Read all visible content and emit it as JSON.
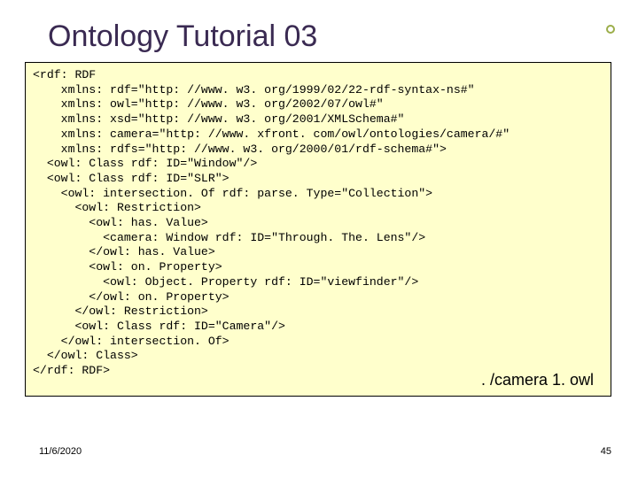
{
  "title": "Ontology Tutorial 03",
  "code_lines": [
    "<rdf: RDF",
    "    xmlns: rdf=\"http: //www. w3. org/1999/02/22-rdf-syntax-ns#\"",
    "    xmlns: owl=\"http: //www. w3. org/2002/07/owl#\"",
    "    xmlns: xsd=\"http: //www. w3. org/2001/XMLSchema#\"",
    "    xmlns: camera=\"http: //www. xfront. com/owl/ontologies/camera/#\"",
    "    xmlns: rdfs=\"http: //www. w3. org/2000/01/rdf-schema#\">",
    "  <owl: Class rdf: ID=\"Window\"/>",
    "  <owl: Class rdf: ID=\"SLR\">",
    "    <owl: intersection. Of rdf: parse. Type=\"Collection\">",
    "      <owl: Restriction>",
    "        <owl: has. Value>",
    "          <camera: Window rdf: ID=\"Through. The. Lens\"/>",
    "        </owl: has. Value>",
    "        <owl: on. Property>",
    "          <owl: Object. Property rdf: ID=\"viewfinder\"/>",
    "        </owl: on. Property>",
    "      </owl: Restriction>",
    "      <owl: Class rdf: ID=\"Camera\"/>",
    "    </owl: intersection. Of>",
    "  </owl: Class>",
    "</rdf: RDF>"
  ],
  "label": ". /camera 1. owl",
  "date": "11/6/2020",
  "page": "45"
}
